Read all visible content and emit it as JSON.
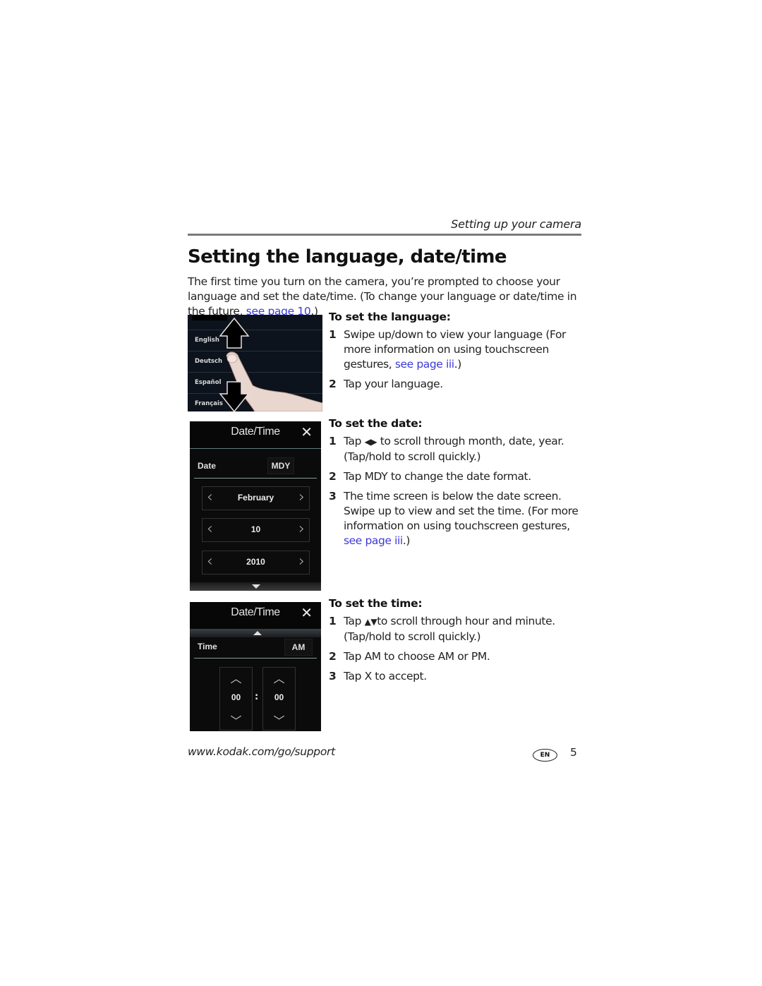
{
  "header": {
    "running_head": "Setting up your camera"
  },
  "page": {
    "title": "Setting the language, date/time",
    "intro_text": "The first time you turn on the camera, you’re prompted to choose your language and set the date/time. (To change your language or date/time in the future, ",
    "intro_link": "see page 10",
    "intro_end": ".)"
  },
  "language_section": {
    "heading": "To set the language:",
    "steps": [
      {
        "num": "1",
        "text": "Swipe up/down to view your language (For more information on using touchscreen gestures, ",
        "link": "see page iii",
        "end": ".)"
      },
      {
        "num": "2",
        "text": "Tap your language."
      }
    ],
    "screen": {
      "languages": [
        "English",
        "Deutsch",
        "Español",
        "Français"
      ],
      "icons": [
        "swipe-up-arrow-icon",
        "finger-icon",
        "swipe-down-arrow-icon"
      ]
    }
  },
  "date_section": {
    "heading": "To set the date:",
    "steps": [
      {
        "num": "1",
        "text_pre": "Tap ",
        "glyphs": "◀▶",
        "text": " to scroll through month, date, year. (Tap/hold to scroll quickly.)"
      },
      {
        "num": "2",
        "text": "Tap MDY to change the date format."
      },
      {
        "num": "3",
        "text": "The time screen is below the date screen. Swipe up to view and set the time. (For more information on using touchscreen gestures, ",
        "link": "see page iii",
        "end": ".)"
      }
    ],
    "screen": {
      "title": "Date/Time",
      "close": "✕",
      "label": "Date",
      "format_button": "MDY",
      "month": "February",
      "day": "10",
      "year": "2010",
      "left": "‹",
      "right": "›"
    }
  },
  "time_section": {
    "heading": "To set the time:",
    "steps": [
      {
        "num": "1",
        "text_pre": "Tap ",
        "glyphs": "▲▼",
        "text": "to scroll through hour and minute. (Tap/hold to scroll quickly.)"
      },
      {
        "num": "2",
        "text": "Tap AM to choose AM or PM."
      },
      {
        "num": "3",
        "text": "Tap X to accept."
      }
    ],
    "screen": {
      "title": "Date/Time",
      "close": "✕",
      "label": "Time",
      "ampm_button": "AM",
      "hour": "00",
      "minute": "00",
      "separator": ":",
      "up": "︿",
      "down": "﹀"
    }
  },
  "footer": {
    "url": "www.kodak.com/go/support",
    "lang_badge": "EN",
    "page_number": "5"
  },
  "colors": {
    "link": "#3a3ad8",
    "rule": "#7a7a7a",
    "screen_bg": "#0b0b0b"
  }
}
